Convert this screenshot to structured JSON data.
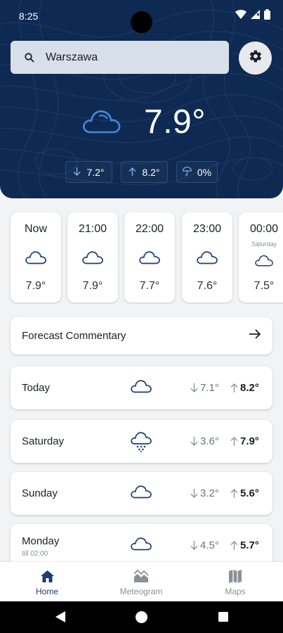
{
  "status_bar": {
    "time": "8:25",
    "icons": [
      "wifi-icon",
      "signal-icon",
      "battery-icon"
    ]
  },
  "search": {
    "value": "Warszawa",
    "icon": "search-icon"
  },
  "settings": {
    "icon": "gear-icon"
  },
  "current": {
    "icon": "cloud-icon",
    "temperature": "7.9°"
  },
  "chips": [
    {
      "icon": "arrow-down-icon",
      "label": "7.2°"
    },
    {
      "icon": "arrow-up-icon",
      "label": "8.2°"
    },
    {
      "icon": "umbrella-icon",
      "label": "0%"
    }
  ],
  "hourly": [
    {
      "hour": "Now",
      "sub": "",
      "icon": "cloud-icon",
      "temp": "7.9°"
    },
    {
      "hour": "21:00",
      "sub": "",
      "icon": "cloud-icon",
      "temp": "7.9°"
    },
    {
      "hour": "22:00",
      "sub": "",
      "icon": "cloud-icon",
      "temp": "7.7°"
    },
    {
      "hour": "23:00",
      "sub": "",
      "icon": "cloud-icon",
      "temp": "7.6°"
    },
    {
      "hour": "00:00",
      "sub": "Saturday",
      "icon": "cloud-icon",
      "temp": "7.5°"
    }
  ],
  "commentary": {
    "label": "Forecast Commentary",
    "icon": "arrow-right-icon"
  },
  "days": [
    {
      "name": "Today",
      "sub": "",
      "icon": "cloud-icon",
      "low": "7.1°",
      "high": "8.2°"
    },
    {
      "name": "Saturday",
      "sub": "",
      "icon": "cloud-rain-icon",
      "low": "3.6°",
      "high": "7.9°"
    },
    {
      "name": "Sunday",
      "sub": "",
      "icon": "cloud-icon",
      "low": "3.2°",
      "high": "5.6°"
    },
    {
      "name": "Monday",
      "sub": "till 02:00",
      "icon": "cloud-icon",
      "low": "4.5°",
      "high": "5.7°"
    }
  ],
  "nav": [
    {
      "label": "Home",
      "icon": "home-icon",
      "active": true
    },
    {
      "label": "Meteogram",
      "icon": "meteogram-icon",
      "active": false
    },
    {
      "label": "Maps",
      "icon": "map-icon",
      "active": false
    }
  ],
  "colors": {
    "header_bg": "#0e2a52",
    "accent": "#1f3b73",
    "card_bg": "#ffffff",
    "page_bg": "#f2f3f5"
  }
}
